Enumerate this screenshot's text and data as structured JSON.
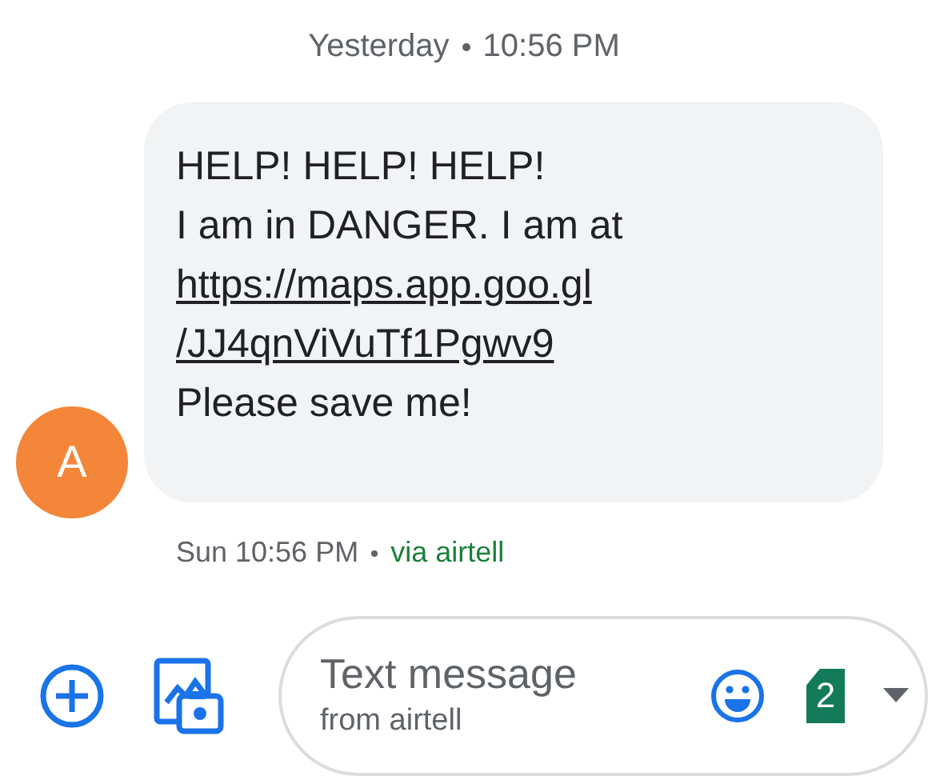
{
  "day_separator": {
    "day": "Yesterday",
    "time": "10:56 PM"
  },
  "message": {
    "avatar": "A",
    "lines": [
      {
        "kind": "text",
        "text": "HELP! HELP! HELP!"
      },
      {
        "kind": "text",
        "text": "I am in DANGER. I am at"
      },
      {
        "kind": "link",
        "text": "https://maps.app.goo.gl"
      },
      {
        "kind": "link",
        "text": "/JJ4qnViVuTf1Pgwv9"
      },
      {
        "kind": "text",
        "text": "Please save me!"
      }
    ],
    "time": "Sun 10:56 PM",
    "via": "via airtell"
  },
  "compose": {
    "placeholder": "Text message",
    "subtitle": "from airtell",
    "sim": "2"
  }
}
